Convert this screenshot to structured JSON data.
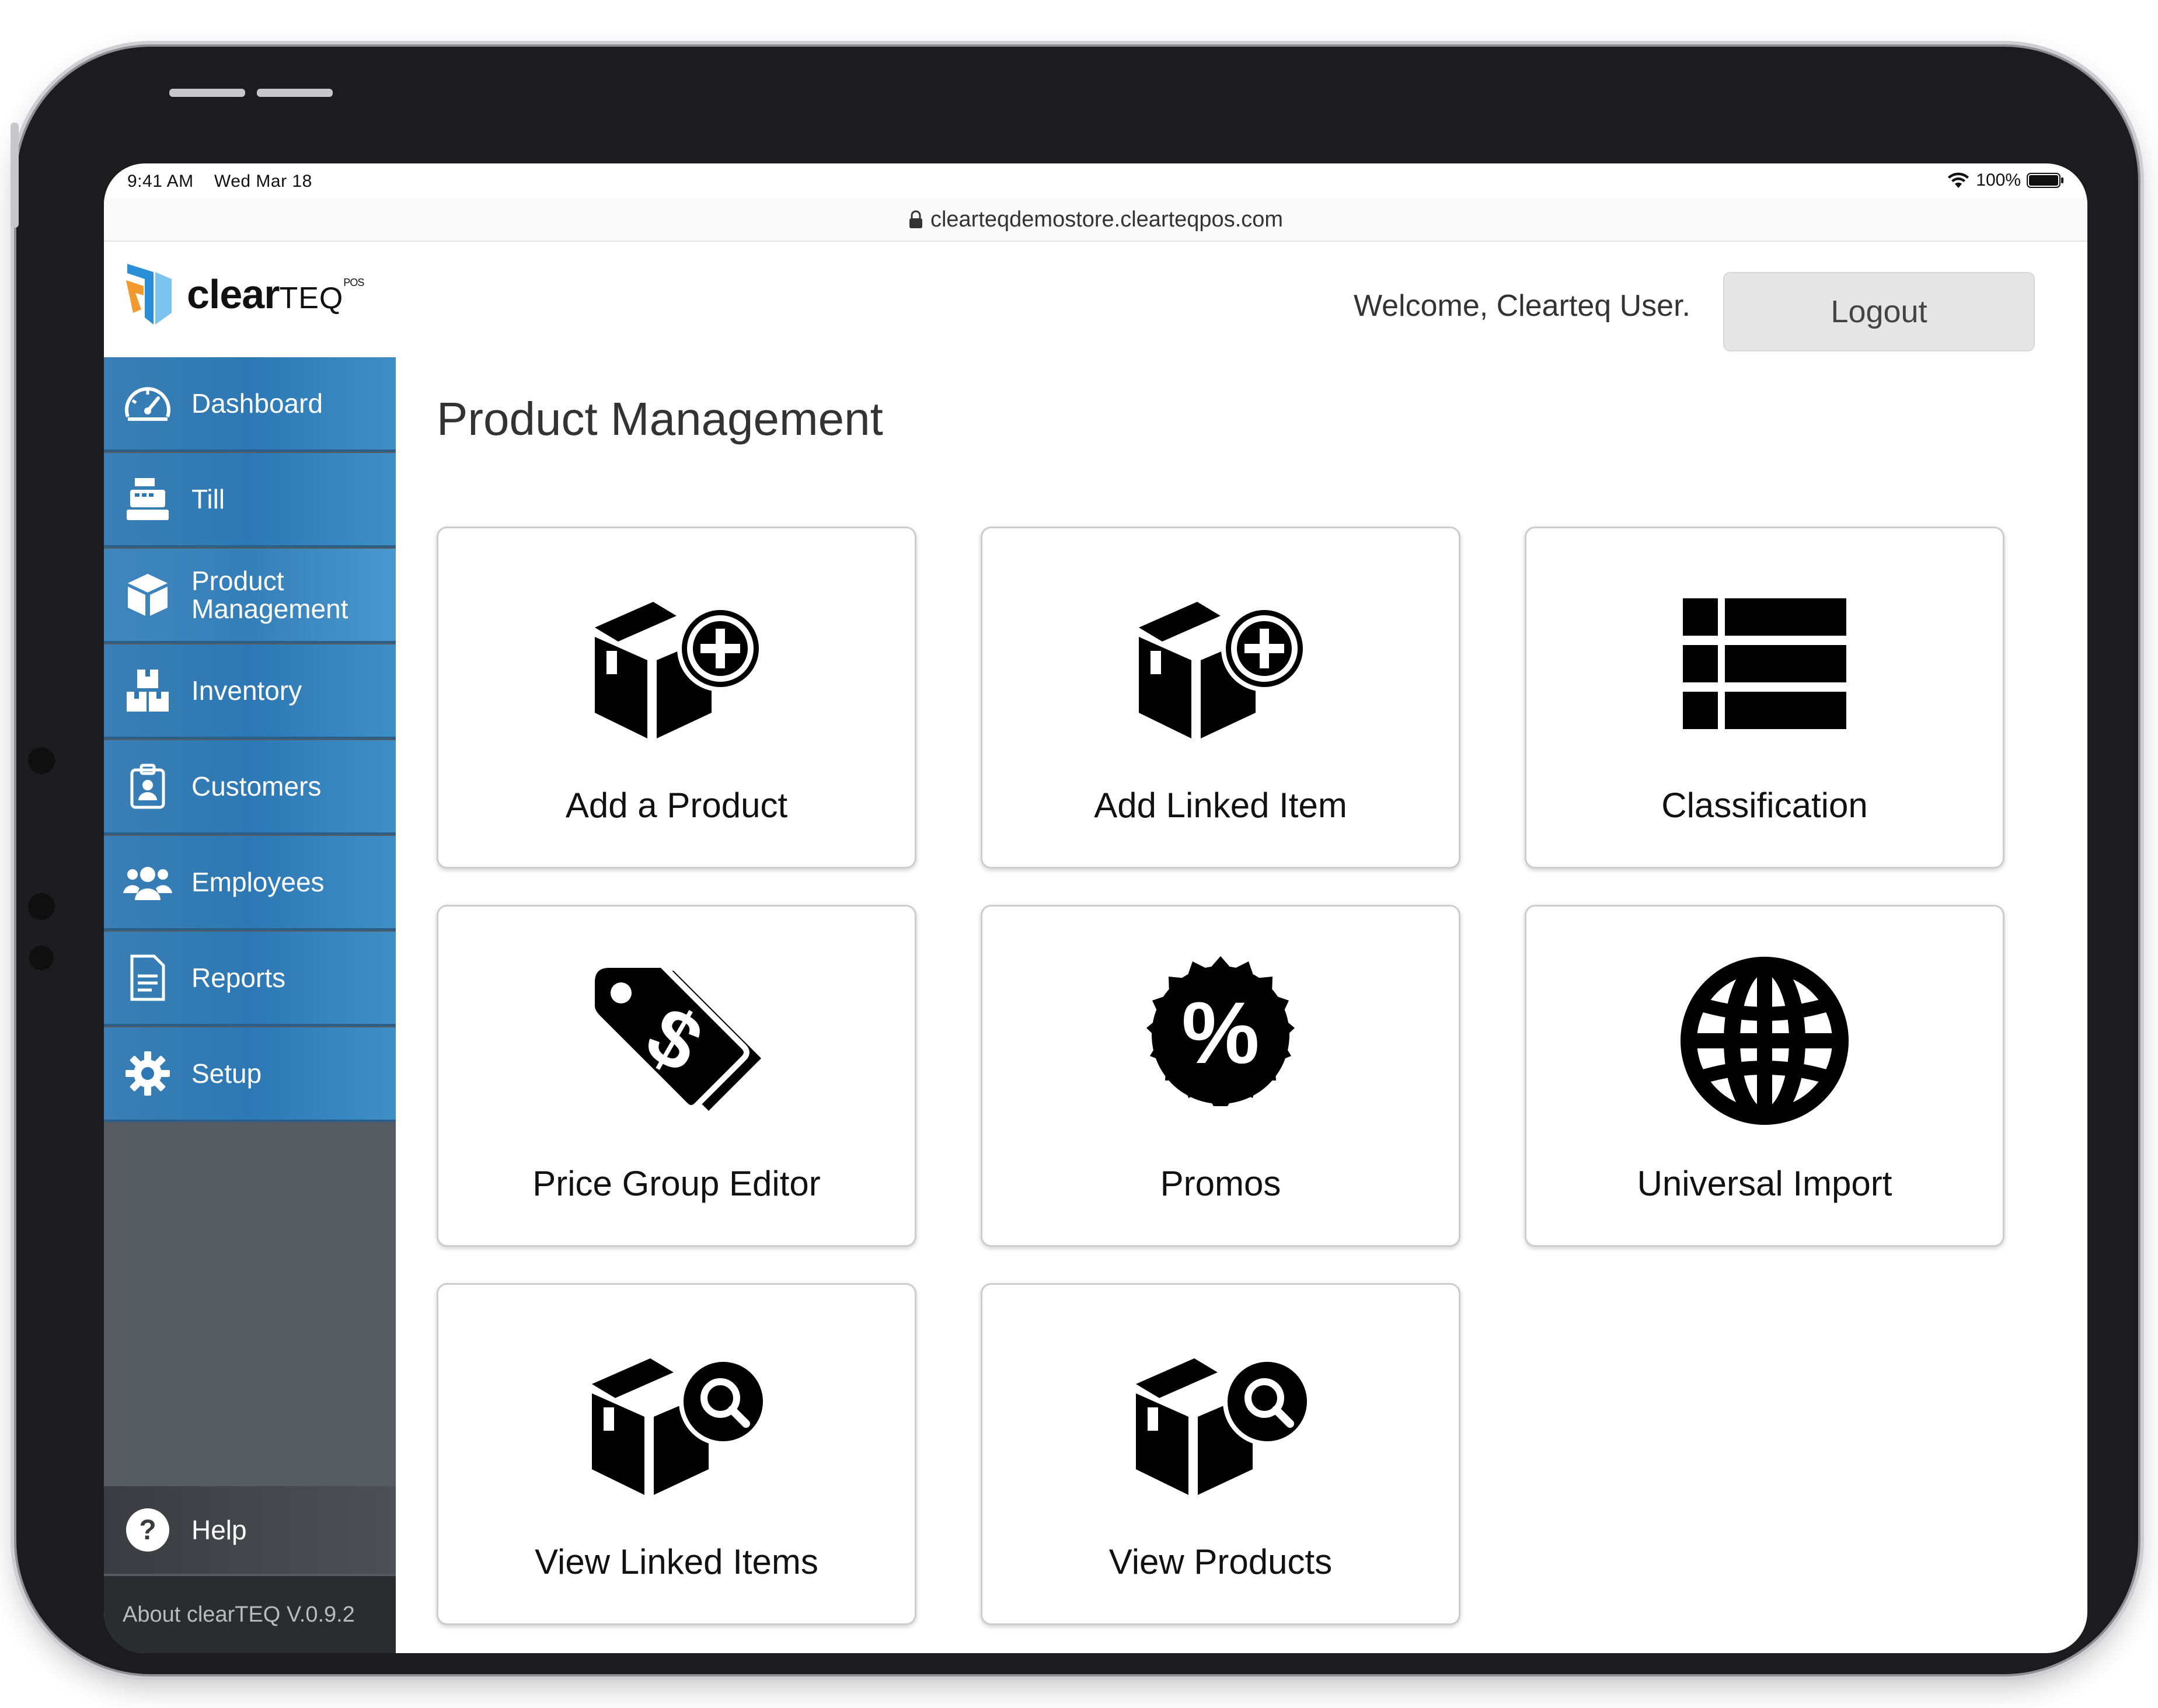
{
  "status_bar": {
    "time": "9:41 AM",
    "date": "Wed Mar 18",
    "battery": "100%"
  },
  "browser": {
    "url": "clearteqdemostore.clearteqpos.com"
  },
  "logo": {
    "text_bold": "clear",
    "text_light": "TEQ",
    "superscript": "POS"
  },
  "header": {
    "welcome": "Welcome, Clearteq User.",
    "logout_label": "Logout"
  },
  "sidebar": {
    "items": [
      {
        "label": "Dashboard",
        "icon": "speedometer-icon"
      },
      {
        "label": "Till",
        "icon": "cash-register-icon"
      },
      {
        "label_line1": "Product",
        "label_line2": "Management",
        "icon": "box-icon",
        "active": true
      },
      {
        "label": "Inventory",
        "icon": "boxes-icon"
      },
      {
        "label": "Customers",
        "icon": "id-badge-icon"
      },
      {
        "label": "Employees",
        "icon": "users-icon"
      },
      {
        "label": "Reports",
        "icon": "document-icon"
      },
      {
        "label": "Setup",
        "icon": "gear-icon"
      }
    ],
    "help_label": "Help",
    "about_label": "About clearTEQ V.0.9.2"
  },
  "main": {
    "title": "Product Management",
    "tiles": [
      {
        "label": "Add a Product",
        "icon": "box-plus-icon"
      },
      {
        "label": "Add Linked Item",
        "icon": "box-plus-icon"
      },
      {
        "label": "Classification",
        "icon": "list-icon"
      },
      {
        "label": "Price Group Editor",
        "icon": "price-tag-icon"
      },
      {
        "label": "Promos",
        "icon": "percent-badge-icon"
      },
      {
        "label": "Universal Import",
        "icon": "globe-icon"
      },
      {
        "label": "View Linked Items",
        "icon": "box-search-icon"
      },
      {
        "label": "View Products",
        "icon": "box-search-icon"
      }
    ]
  },
  "colors": {
    "nav_blue": "#2d78b4",
    "sidebar_gray": "#565a61",
    "logo_orange": "#f29a2e",
    "logo_blue": "#2a8fd6"
  }
}
